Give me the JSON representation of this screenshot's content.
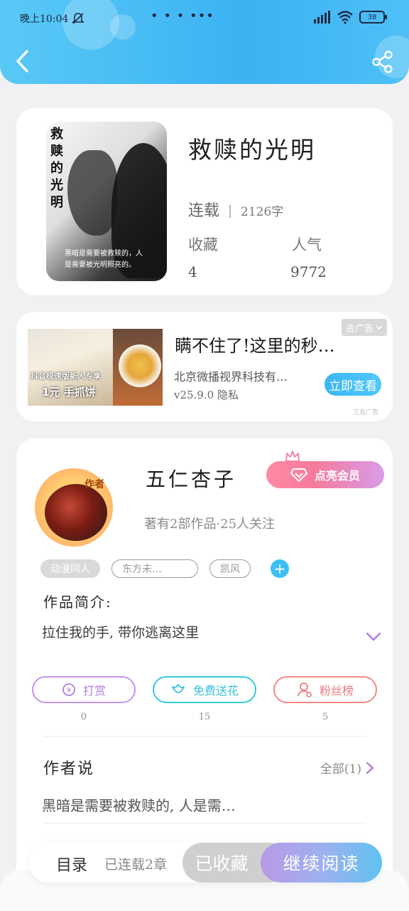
{
  "status_bar": {
    "time": "晚上10:04",
    "dots": "• • • •••",
    "battery": "38"
  },
  "book": {
    "title": "救赎的光明",
    "status": "连载",
    "words": "2126字",
    "favorites_label": "收藏",
    "favorites_value": "4",
    "popularity_label": "人气",
    "popularity_value": "9772",
    "cover_title": "救赎的光明",
    "cover_caption_line1": "黑暗是需要被救赎的，人",
    "cover_caption_line2": "是需要被光明照亮的。"
  },
  "ad": {
    "badge": "去广告",
    "title": "瞒不住了!这里的秒…",
    "company": "北京微播视界科技有…",
    "version": "v25.9.0 隐私",
    "cta": "立即查看",
    "foot": "三及广告",
    "image_text_1": "抖音极速版新人专享",
    "image_text_2": "1元 手抓饼"
  },
  "author": {
    "name": "五仁杏子",
    "avatar_tag": "作者",
    "meta": "著有2部作品·25人关注",
    "vip_label": "点亮会员",
    "tags": [
      "动漫同人",
      "东方未…",
      "凯风"
    ],
    "intro_title": "作品简介:",
    "intro_text": "拉住我的手, 带你逃离这里",
    "actions": [
      {
        "label": "打赏",
        "count": "0"
      },
      {
        "label": "免费送花",
        "count": "15"
      },
      {
        "label": "粉丝榜",
        "count": "5"
      }
    ],
    "say_title": "作者说",
    "say_all": "全部(1)",
    "say_text": "黑暗是需要被救赎的, 人是需…"
  },
  "bottom_bar": {
    "toc_label": "目录",
    "toc_info": "已连载2章",
    "favorite": "已收藏",
    "continue": "继续阅读"
  },
  "colors": {
    "header_blue": "#3bb2f2",
    "accent_cyan": "#3cc0f3",
    "vip_pink": "#f77a9c",
    "reward_purple": "#b07de0",
    "flower_teal": "#35c2d8",
    "fans_red": "#ec7b7b"
  }
}
